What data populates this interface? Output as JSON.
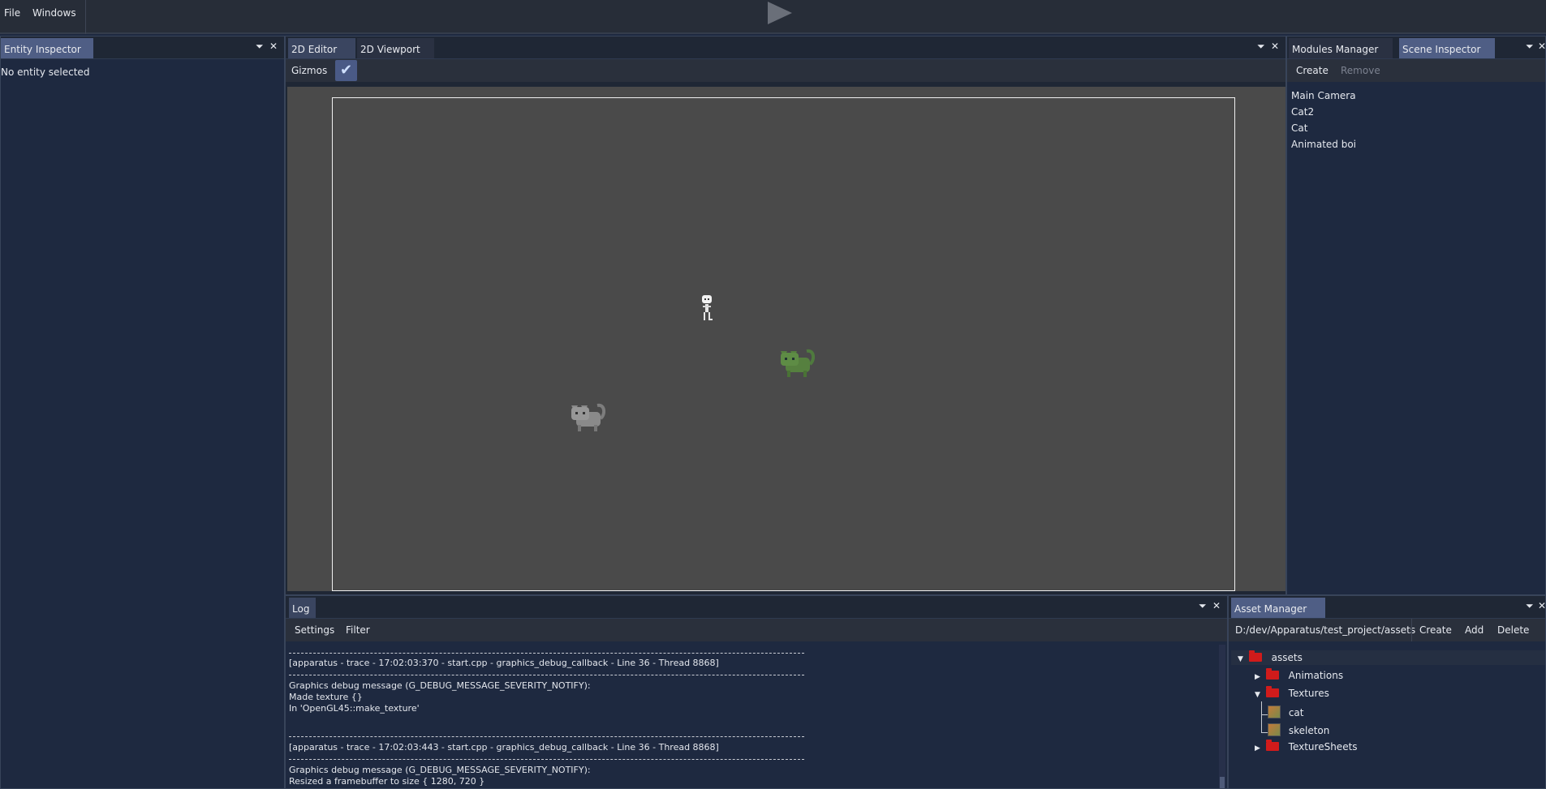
{
  "menubar": {
    "file": "File",
    "windows": "Windows"
  },
  "entity_inspector": {
    "tab": "Entity Inspector",
    "empty_text": "No entity selected"
  },
  "editor": {
    "tabs": [
      "2D Editor",
      "2D Viewport"
    ],
    "gizmos_label": "Gizmos",
    "gizmos_checked": true
  },
  "right_panel": {
    "tabs": [
      "Modules Manager",
      "Scene Inspector"
    ],
    "create": "Create",
    "remove": "Remove",
    "entities": [
      "Main Camera",
      "Cat2",
      "Cat",
      "Animated boi"
    ]
  },
  "log": {
    "tab": "Log",
    "settings": "Settings",
    "filter": "Filter",
    "lines": [
      "[apparatus - trace - 17:02:03:370 - start.cpp - graphics_debug_callback - Line 36 - Thread 8868]",
      "Graphics debug message (G_DEBUG_MESSAGE_SEVERITY_NOTIFY):",
      "Made texture {}",
      "In 'OpenGL45::make_texture'",
      "[apparatus - trace - 17:02:03:443 - start.cpp - graphics_debug_callback - Line 36 - Thread 8868]",
      "Graphics debug message (G_DEBUG_MESSAGE_SEVERITY_NOTIFY):",
      "Resized a framebuffer to size { 1280, 720 }"
    ]
  },
  "assets": {
    "tab": "Asset Manager",
    "path": "D:/dev/Apparatus/test_project/assets",
    "create": "Create",
    "add": "Add",
    "delete": "Delete",
    "tree": {
      "root": "assets",
      "animations": "Animations",
      "textures": "Textures",
      "cat": "cat",
      "skeleton": "skeleton",
      "texturesheets": "TextureSheets"
    }
  },
  "icons": {
    "play": "play-icon",
    "dropdown": "dropdown-icon",
    "close": "close-icon",
    "folder": "folder-icon",
    "texture": "texture-thumbnail-icon"
  },
  "colors": {
    "background": "#1e2940",
    "menubar": "#272d38",
    "active_tab": "#4f5e85",
    "viewport": "#4a4a4a",
    "folder": "#d11b1b"
  }
}
